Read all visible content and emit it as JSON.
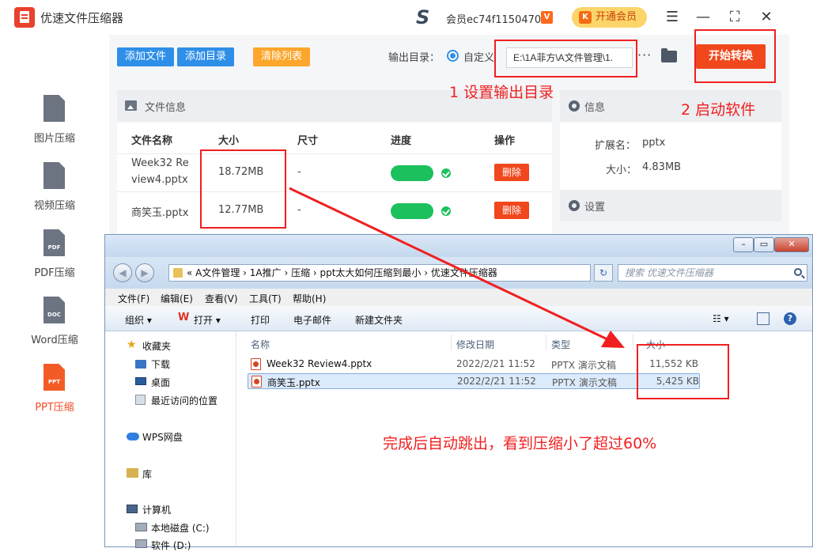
{
  "app": {
    "title": "优速文件压缩器",
    "member": "会员ec74f1150470",
    "vip_badge": "V",
    "open_vip": "开通会员",
    "open_vip_icon": "K",
    "menu_glyph": "☰",
    "minimize_glyph": "—",
    "maximize_glyph": "⛶",
    "close_glyph": "✕"
  },
  "sidebar": {
    "items": [
      {
        "label": "图片压缩",
        "icon": "image-icon",
        "badge": ""
      },
      {
        "label": "视频压缩",
        "icon": "video-icon",
        "badge": ""
      },
      {
        "label": "PDF压缩",
        "icon": "pdf-icon",
        "badge": "PDF"
      },
      {
        "label": "Word压缩",
        "icon": "doc-icon",
        "badge": "DOC"
      },
      {
        "label": "PPT压缩",
        "icon": "ppt-icon",
        "badge": "PPT",
        "active": true
      }
    ]
  },
  "toolbar": {
    "add_file": "添加文件",
    "add_dir": "添加目录",
    "clear_list": "清除列表",
    "output_label": "输出目录：",
    "custom_label": "自定义",
    "output_path": "E:\\1A菲方\\A文件管理\\1.",
    "more": "···",
    "start": "开始转换"
  },
  "file_panel": {
    "title": "文件信息",
    "columns": [
      "文件名称",
      "大小",
      "尺寸",
      "进度",
      "操作"
    ],
    "rows": [
      {
        "name_line1": "Week32 Re",
        "name_line2": "view4.pptx",
        "size": "18.72MB",
        "dim": "-",
        "action": "删除"
      },
      {
        "name": "商笑玉.pptx",
        "size": "12.77MB",
        "dim": "-",
        "action": "删除"
      }
    ]
  },
  "info_panel": {
    "title": "信息",
    "ext_label": "扩展名：",
    "ext_value": "pptx",
    "size_label": "大小：",
    "size_value": "4.83MB",
    "settings_title": "设置"
  },
  "annotations": {
    "step1": "1 设置输出目录",
    "step2": "2 启动软件",
    "done": "完成后自动跳出，看到压缩小了超过60%"
  },
  "explorer": {
    "address": "«  A文件管理  ›  1A推广  ›  压缩  ›  ppt太大如何压缩到最小  ›  优速文件压缩器",
    "search_placeholder": "搜索 优速文件压缩器",
    "menu": [
      "文件(F)",
      "编辑(E)",
      "查看(V)",
      "工具(T)",
      "帮助(H)"
    ],
    "tools": {
      "organize": "组织 ▾",
      "open": "打开 ▾",
      "print": "打印",
      "email": "电子邮件",
      "new_folder": "新建文件夹"
    },
    "nav": {
      "favorites": "收藏夹",
      "downloads": "下载",
      "desktop": "桌面",
      "recent": "最近访问的位置",
      "wps": "WPS网盘",
      "library": "库",
      "computer": "计算机",
      "local_c": "本地磁盘 (C:)",
      "soft_d": "软件 (D:)"
    },
    "columns": {
      "name": "名称",
      "date": "修改日期",
      "type": "类型",
      "size": "大小"
    },
    "files": [
      {
        "name": "Week32 Review4.pptx",
        "date": "2022/2/21 11:52",
        "type": "PPTX 演示文稿",
        "size": "11,552 KB"
      },
      {
        "name": "商笑玉.pptx",
        "date": "2022/2/21 11:52",
        "type": "PPTX 演示文稿",
        "size": "5,425 KB"
      }
    ]
  },
  "colors": {
    "accent_red": "#f1471d",
    "blue": "#2e8fe8",
    "green": "#1cc05c",
    "annotation": "#f02020"
  }
}
